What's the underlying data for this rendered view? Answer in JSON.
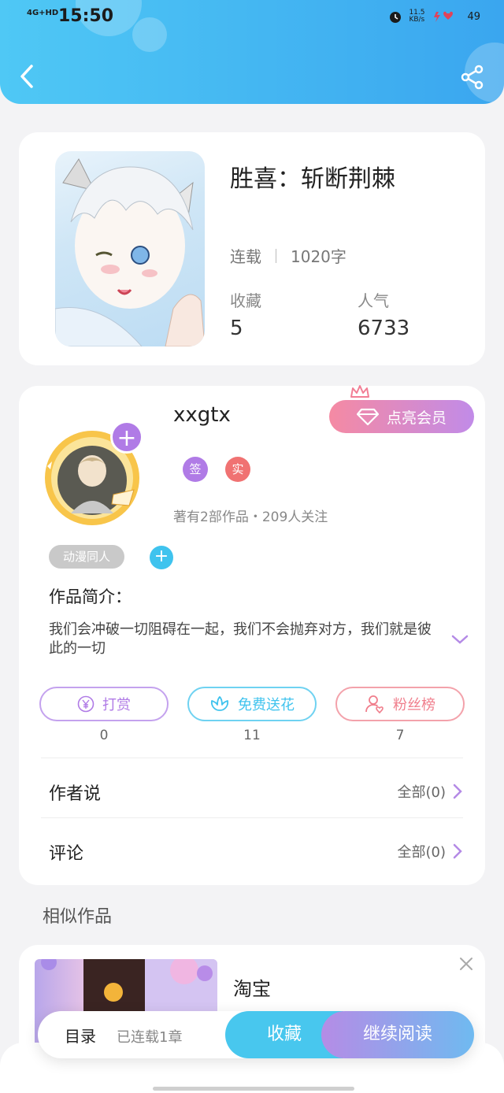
{
  "status_bar": {
    "network": "4G+HD",
    "time": "15:50",
    "speed": "11.5 KB/s",
    "battery": "49"
  },
  "book": {
    "title": "胜喜：斩断荆棘",
    "status": "连载",
    "word_count": "1020字",
    "favorites_label": "收藏",
    "favorites_value": "5",
    "popularity_label": "人气",
    "popularity_value": "6733"
  },
  "author": {
    "name": "xxgtx",
    "vip_label": "点亮会员",
    "badges": [
      "签",
      "实"
    ],
    "works_info": "著有2部作品・209人关注",
    "tag": "动漫同人",
    "intro_title": "作品简介：",
    "intro_text": "我们会冲破一切阻碍在一起，我们不会抛弃对方，我们就是彼此的一切"
  },
  "actions": [
    {
      "label": "打赏",
      "count": "0",
      "color": "#b07be6"
    },
    {
      "label": "免费送花",
      "count": "11",
      "color": "#3fc3ee"
    },
    {
      "label": "粉丝榜",
      "count": "7",
      "color": "#f07e8c"
    }
  ],
  "rows": {
    "author_says": {
      "label": "作者说",
      "right": "全部(0)"
    },
    "comments": {
      "label": "评论",
      "right": "全部(0)"
    }
  },
  "similar": {
    "title": "相似作品",
    "item_name": "淘宝"
  },
  "bottom_bar": {
    "toc": "目录",
    "chapters": "已连载1章",
    "favorite": "收藏",
    "continue": "继续阅读"
  }
}
